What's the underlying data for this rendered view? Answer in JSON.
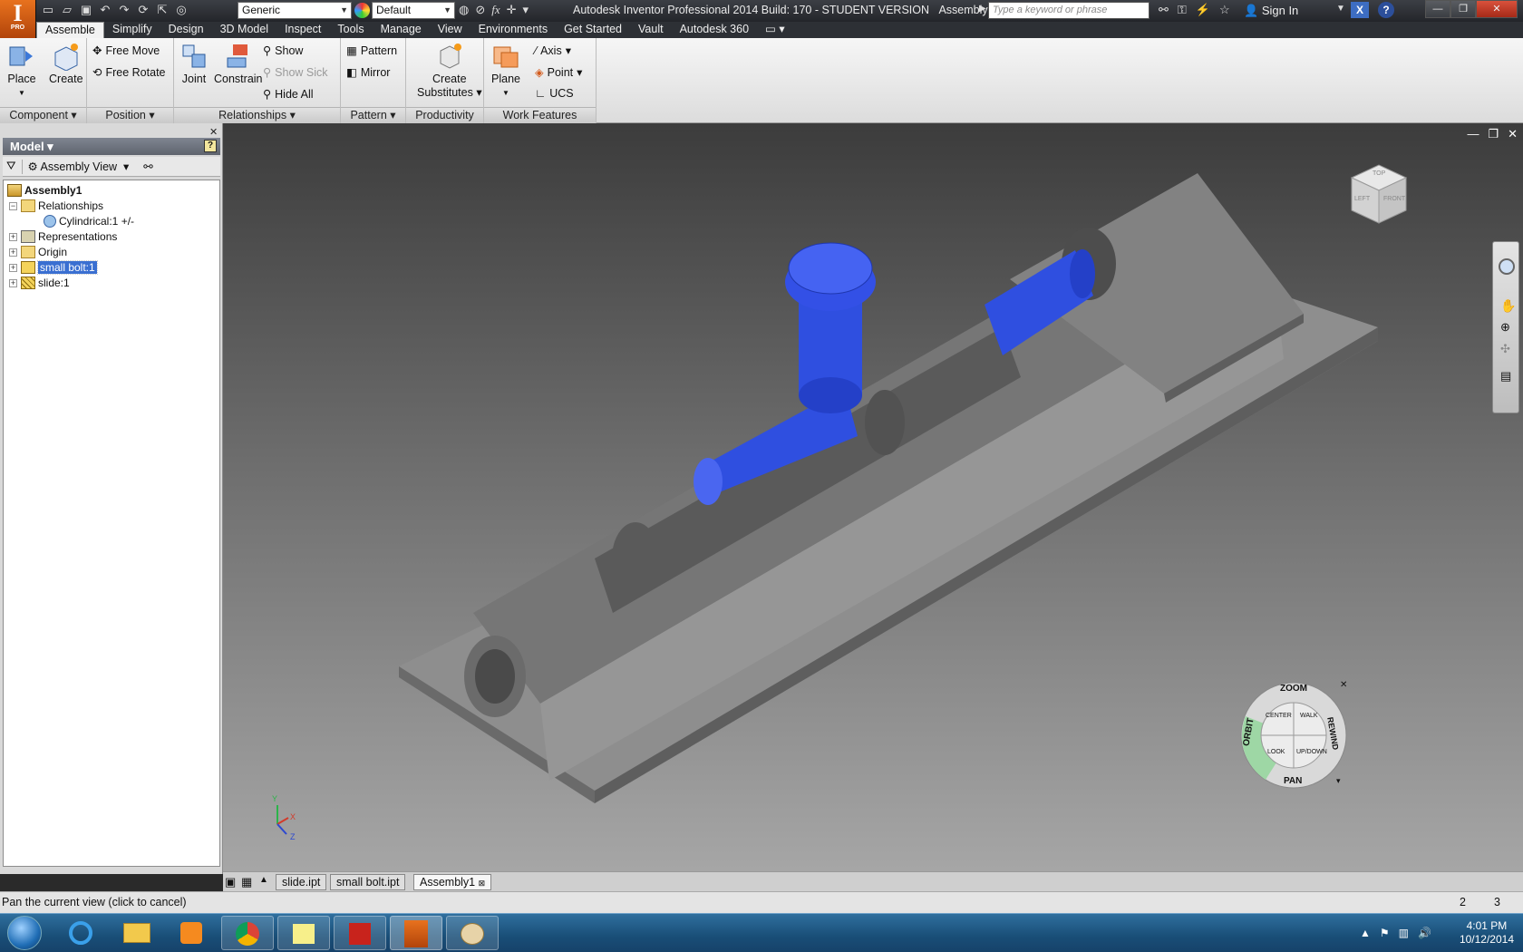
{
  "window": {
    "title": "Autodesk Inventor Professional 2014 Build: 170 - STUDENT VERSION",
    "document": "Assembly1",
    "logo_letter": "I",
    "logo_sub": "PRO"
  },
  "quick_access": {
    "appearance": "Generic",
    "material": "Default"
  },
  "search": {
    "placeholder": "Type a keyword or phrase"
  },
  "user": {
    "sign_in": "Sign In"
  },
  "menu_tabs": [
    "Assemble",
    "Simplify",
    "Design",
    "3D Model",
    "Inspect",
    "Tools",
    "Manage",
    "View",
    "Environments",
    "Get Started",
    "Vault",
    "Autodesk 360"
  ],
  "ribbon": {
    "component": {
      "label": "Component",
      "place": "Place",
      "create": "Create"
    },
    "position": {
      "label": "Position",
      "free_move": "Free Move",
      "free_rotate": "Free Rotate"
    },
    "relationships": {
      "label": "Relationships",
      "joint": "Joint",
      "constrain": "Constrain",
      "show": "Show",
      "show_sick": "Show Sick",
      "hide_all": "Hide All"
    },
    "pattern": {
      "label": "Pattern",
      "pattern": "Pattern",
      "mirror": "Mirror"
    },
    "productivity": {
      "label": "Productivity",
      "create_substitutes_1": "Create",
      "create_substitutes_2": "Substitutes"
    },
    "work_features": {
      "label": "Work Features",
      "plane": "Plane",
      "axis": "Axis",
      "point": "Point",
      "ucs": "UCS"
    }
  },
  "browser": {
    "title": "Model",
    "view": "Assembly View",
    "tree": {
      "root": "Assembly1",
      "relationships": "Relationships",
      "cylindrical": "Cylindrical:1 +/-",
      "representations": "Representations",
      "origin": "Origin",
      "small_bolt": "small bolt:1",
      "slide": "slide:1"
    }
  },
  "viewcube": {
    "top": "TOP",
    "left": "LEFT",
    "front": "FRONT"
  },
  "steering_wheel": {
    "zoom": "ZOOM",
    "orbit": "ORBIT",
    "pan": "PAN",
    "rewind": "REWIND",
    "center": "CENTER",
    "walk": "WALK",
    "look": "LOOK",
    "updown": "UP/DOWN"
  },
  "axis_triad": {
    "x": "X",
    "y": "Y",
    "z": "Z"
  },
  "doc_tabs": [
    "slide.ipt",
    "small bolt.ipt",
    "Assembly1"
  ],
  "status": {
    "message": "Pan the current view (click to cancel)",
    "count1": "2",
    "count2": "3"
  },
  "taskbar": {
    "time": "4:01 PM",
    "date": "10/12/2014"
  },
  "colors": {
    "selected_part": "#2f4fe0",
    "part_gray": "#8a8a8a",
    "accent": "#e8721e"
  }
}
